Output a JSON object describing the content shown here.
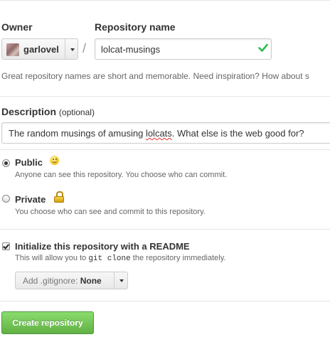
{
  "form": {
    "owner_label": "Owner",
    "owner_value": "garlovel",
    "separator": "/",
    "repo_label": "Repository name",
    "repo_value": "lolcat-musings",
    "hint": "Great repository names are short and memorable. Need inspiration? How about s",
    "description_label": "Description",
    "description_optional": "(optional)",
    "description_before": "The random musings of amusing ",
    "description_misspelled": "lolcats",
    "description_after": ". What else is the web good for?"
  },
  "visibility": {
    "selected": "public",
    "public_label": "Public",
    "public_desc": "Anyone can see this repository. You choose who can commit.",
    "private_label": "Private",
    "private_desc": "You choose who can see and commit to this repository."
  },
  "readme": {
    "checked": true,
    "label": "Initialize this repository with a README",
    "desc_before": "This will allow you to ",
    "desc_code": "git clone",
    "desc_after": " the repository immediately."
  },
  "gitignore": {
    "label": "Add .gitignore:",
    "value": "None"
  },
  "submit": {
    "label": "Create repository",
    "color": "#60b044"
  },
  "icons": {
    "owner_avatar": "avatar",
    "repo_valid": "check-icon",
    "public": "smiley-icon",
    "private": "lock-icon"
  },
  "colors": {
    "valid_check": "#2cbe4e",
    "spell_underline": "#e03030"
  }
}
